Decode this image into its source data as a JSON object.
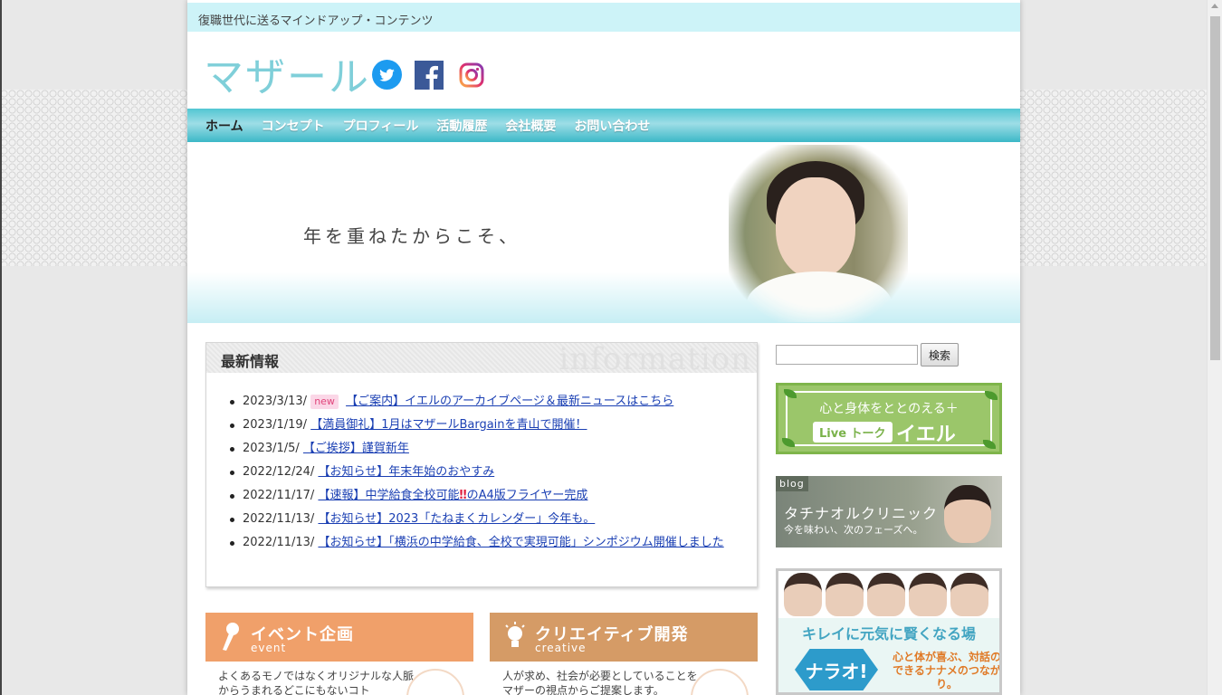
{
  "header": {
    "tagline": "復職世代に送るマインドアップ・コンテンツ",
    "logo": "マザール",
    "social": [
      "twitter-icon",
      "facebook-icon",
      "instagram-icon"
    ]
  },
  "nav": {
    "items": [
      {
        "label": "ホーム"
      },
      {
        "label": "コンセプト"
      },
      {
        "label": "プロフィール"
      },
      {
        "label": "活動履歴"
      },
      {
        "label": "会社概要"
      },
      {
        "label": "お問い合わせ"
      }
    ]
  },
  "hero": {
    "text": "年を重ねたからこそ、"
  },
  "info": {
    "title": "最新情報",
    "bg_word": "information",
    "new_badge": "new",
    "items": [
      {
        "date": "2023/3/13/",
        "link": "【ご案内】イエルのアーカイブページ＆最新ニュースはこちら",
        "is_new": true
      },
      {
        "date": "2023/1/19/",
        "link": "【満員御礼】1月はマザールBargainを青山で開催！"
      },
      {
        "date": "2023/1/5/",
        "link": "【ご挨拶】謹賀新年"
      },
      {
        "date": "2022/12/24/",
        "link": "【お知らせ】年末年始のおやすみ"
      },
      {
        "date": "2022/11/17/",
        "link": "【速報】中学給食全校可能",
        "excl": "‼",
        "link2": "のA4版フライヤー完成"
      },
      {
        "date": "2022/11/13/",
        "link": "【お知らせ】2023「たねまくカレンダー」今年も。"
      },
      {
        "date": "2022/11/13/",
        "link": "【お知らせ】「横浜の中学給食、全校で実現可能」シンポジウム開催しました"
      }
    ]
  },
  "cards": {
    "event": {
      "title": "イベント企画",
      "sub": "event",
      "text": "よくあるモノではなくオリジナルな人脈からうまれるどこにもないコト"
    },
    "creative": {
      "title": "クリエイティブ開発",
      "sub": "creative",
      "text": "人が求め、社会が必要としていることをマザーの視点からご提案します。"
    }
  },
  "sidebar": {
    "search_button": "検索",
    "yell": {
      "line1": "心と身体をととのえる＋",
      "live": "Live トーク",
      "name": "イエル"
    },
    "blog": {
      "tag": "blog",
      "title": "タチナオルクリニック",
      "sub": "今を味わい、次のフェーズへ。"
    },
    "narao": {
      "head": "キレイに元気に賢くなる場",
      "name": "ナラオ!",
      "text": "心と体が喜ぶ、対話のできるナナメのつながり。"
    }
  }
}
